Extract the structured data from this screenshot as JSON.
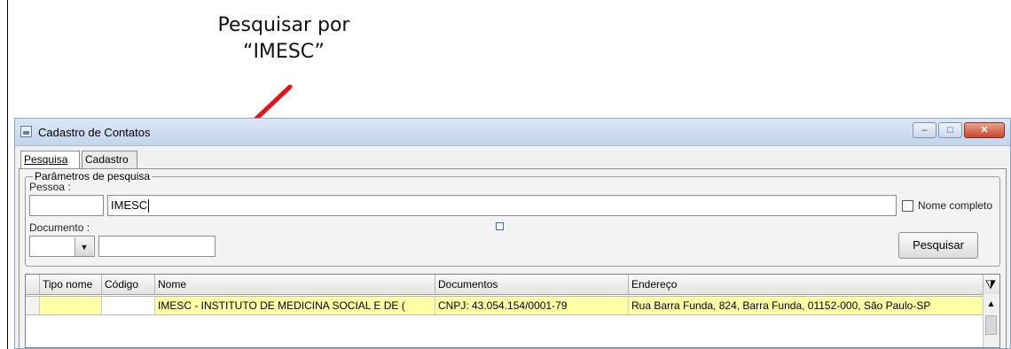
{
  "annotation": {
    "line1": "Pesquisar por",
    "line2": "“IMESC”"
  },
  "window": {
    "title": "Cadastro de Contatos",
    "controls": {
      "minimize": "–",
      "maximize": "□",
      "close": "✕"
    }
  },
  "tabs": [
    {
      "label": "Pesquisa",
      "active": true
    },
    {
      "label": "Cadastro",
      "active": false
    }
  ],
  "search": {
    "group_label": "Parâmetros de pesquisa",
    "pessoa_label": "Pessoa :",
    "pessoa_code_value": "",
    "pessoa_name_value": "IMESC",
    "nome_completo_label": "Nome completo",
    "nome_completo_checked": false,
    "documento_label": "Documento :",
    "documento_type_value": "",
    "documento_value": "",
    "search_button": "Pesquisar"
  },
  "grid": {
    "columns": [
      "Tipo nome",
      "Código",
      "Nome",
      "Documentos",
      "Endereço"
    ],
    "rows": [
      {
        "tipo_nome": "",
        "codigo": "",
        "nome": "IMESC - INSTITUTO DE MEDICINA SOCIAL E DE (",
        "documentos": "CNPJ: 43.054.154/0001-79",
        "endereco": "Rua Barra Funda, 824, Barra Funda, 01152-000, São Paulo-SP"
      }
    ]
  },
  "icons": {
    "app": "window-icon",
    "filter": "filter-icon",
    "combo": "chevron-down-icon",
    "scroll_up": "chevron-up-icon"
  },
  "colors": {
    "annotation_arrow": "#e8111b",
    "selected_row": "#ffffa8",
    "titlebar": "#c3d5ec",
    "close_button": "#c8452b"
  }
}
